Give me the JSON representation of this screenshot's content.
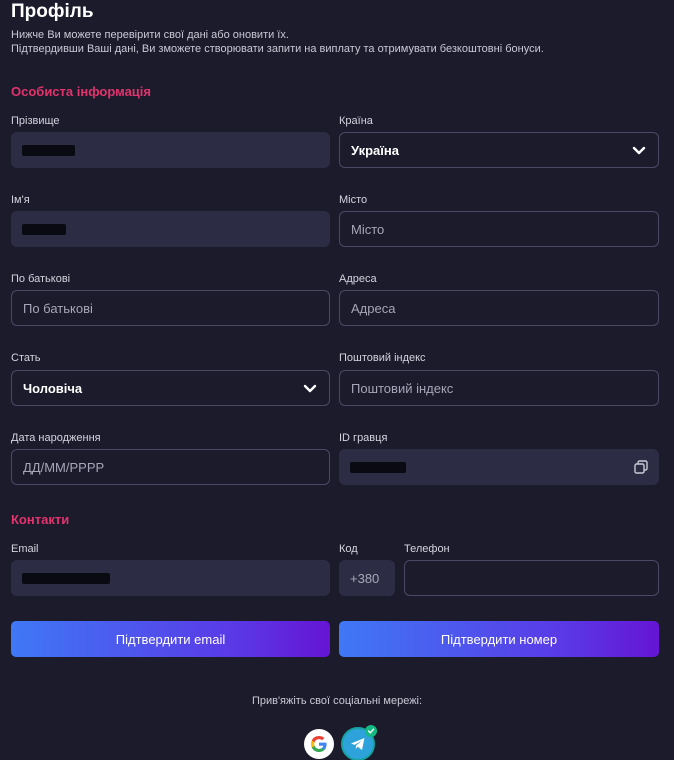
{
  "header": {
    "title": "Профіль",
    "subtitle_line1": "Нижче Ви можете перевірити свої дані або оновити їх.",
    "subtitle_line2": "Підтвердивши Ваші дані, Ви зможете створювати запити на виплату та отримувати безкоштовні бонуси."
  },
  "personal": {
    "section_title": "Особиста інформація",
    "surname": {
      "label": "Прізвище",
      "value": ""
    },
    "country": {
      "label": "Країна",
      "value": "Україна"
    },
    "first_name": {
      "label": "Ім'я",
      "value": ""
    },
    "city": {
      "label": "Місто",
      "placeholder": "Місто"
    },
    "patronymic": {
      "label": "По батькові",
      "placeholder": "По батькові"
    },
    "address": {
      "label": "Адреса",
      "placeholder": "Адреса"
    },
    "gender": {
      "label": "Стать",
      "value": "Чоловіча"
    },
    "postal_code": {
      "label": "Поштовий індекс",
      "placeholder": "Поштовий індекс"
    },
    "birth_date": {
      "label": "Дата народження",
      "placeholder": "ДД/ММ/РРРР"
    },
    "player_id": {
      "label": "ID гравця",
      "value": ""
    }
  },
  "contacts": {
    "section_title": "Контакти",
    "email": {
      "label": "Email",
      "value": ""
    },
    "code": {
      "label": "Код",
      "value": "+380"
    },
    "phone": {
      "label": "Телефон",
      "value": ""
    }
  },
  "buttons": {
    "verify_email": "Підтвердити email",
    "verify_phone": "Підтвердити номер"
  },
  "social": {
    "label": "Прив'яжіть свої соціальні мережі:",
    "google_icon": "google-icon",
    "telegram_icon": "telegram-icon",
    "telegram_linked": true
  },
  "colors": {
    "background": "#1c1b2b",
    "accent_section": "#e2336d",
    "button_gradient_start": "#3f78f6",
    "button_gradient_end": "#6515d4"
  }
}
